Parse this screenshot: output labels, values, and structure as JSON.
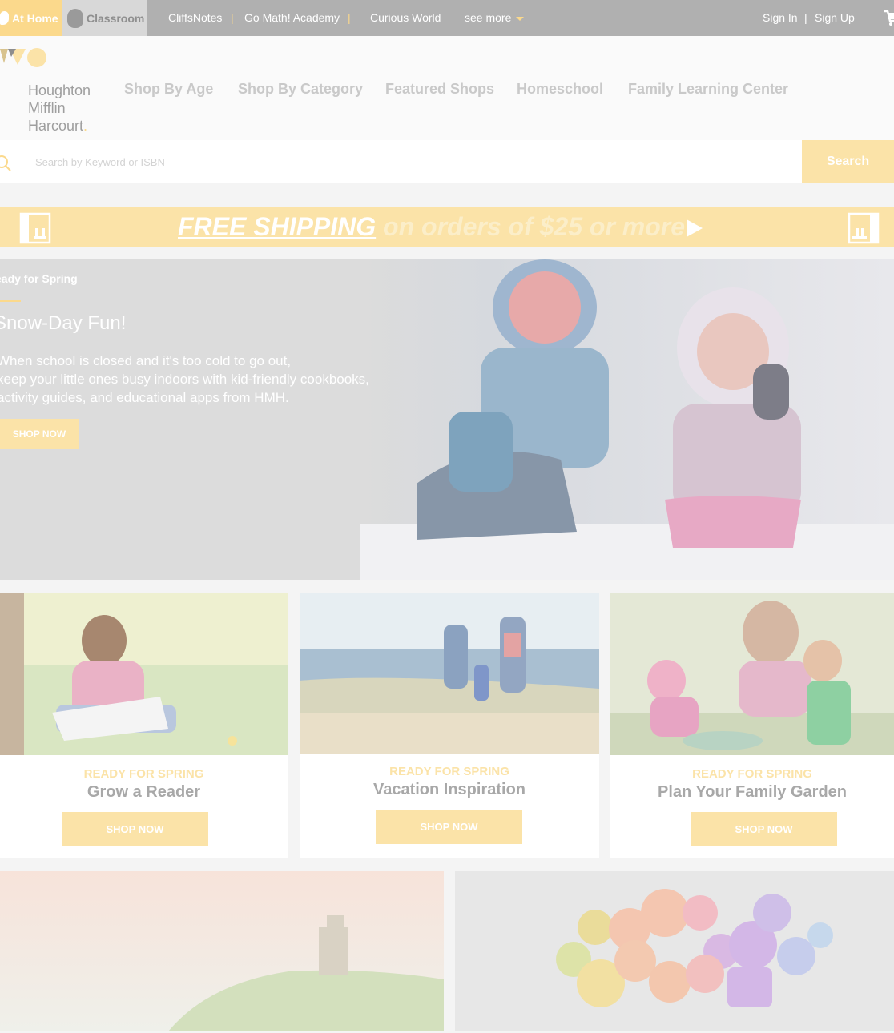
{
  "topbar": {
    "at_home": "At Home",
    "classroom": "Classroom",
    "links": [
      "CliffsNotes",
      "Go Math! Academy",
      "Curious World"
    ],
    "separator": "|",
    "see_more": "see more",
    "sign_in": "Sign In",
    "sign_up": "Sign Up",
    "account_separator": "|"
  },
  "logo": {
    "line1": "Houghton",
    "line2": "Mifflin",
    "line3": "Harcourt",
    "dot": "."
  },
  "main_nav": [
    "Shop By Age",
    "Shop By Category",
    "Featured Shops",
    "Homeschool",
    "Family Learning Center"
  ],
  "search": {
    "placeholder": "Search by Keyword or ISBN",
    "button": "Search"
  },
  "promo": {
    "free_shipping": "FREE SHIPPING",
    "rest": "on orders of $25 or more"
  },
  "hero": {
    "kicker": "eady for Spring",
    "title": "Snow-Day Fun!",
    "body_line1": "When school is closed and it's too cold to go out,",
    "body_line2": "keep your little ones busy indoors with kid-friendly cookbooks,",
    "body_line3": "activity guides, and educational apps from HMH.",
    "button": "SHOP NOW"
  },
  "cards": [
    {
      "kicker": "READY FOR SPRING",
      "title": "Grow a Reader",
      "button": "SHOP NOW"
    },
    {
      "kicker": "READY FOR SPRING",
      "title": "Vacation Inspiration",
      "button": "SHOP NOW"
    },
    {
      "kicker": "READY FOR SPRING",
      "title": "Plan Your Family Garden",
      "button": "SHOP NOW"
    }
  ],
  "colors": {
    "accent": "#fbd98c",
    "accent_light": "#fbe3a8",
    "topbar": "#b0b0b0"
  },
  "icons": [
    "home-icon",
    "apple-icon",
    "cart-icon",
    "search-icon",
    "building-icon",
    "play-arrow-icon",
    "caret-down-icon"
  ]
}
